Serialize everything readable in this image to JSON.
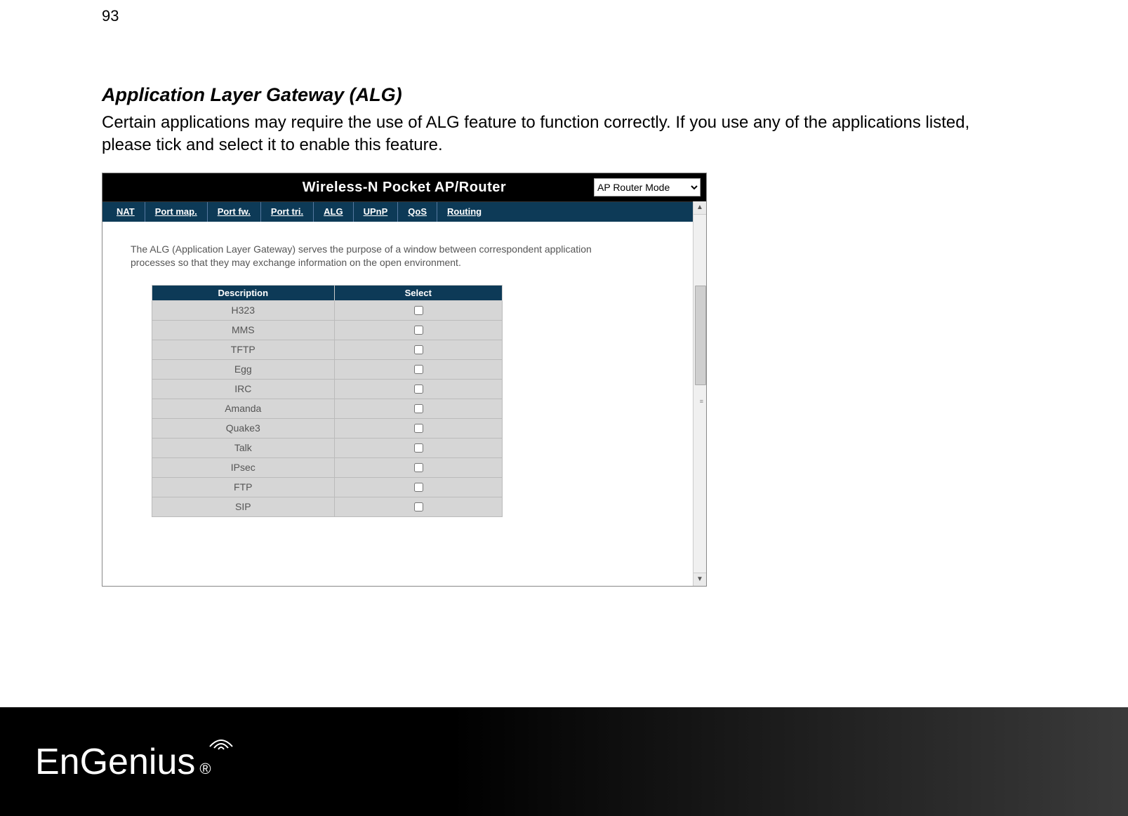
{
  "page_number": "93",
  "section": {
    "title": "Application Layer Gateway (ALG)",
    "body": "Certain applications may require the use of ALG feature to function correctly. If you use any of the applications listed, please tick and select it to enable this feature."
  },
  "app": {
    "title": "Wireless-N Pocket AP/Router",
    "mode_selected": "AP Router Mode",
    "nav_tabs": [
      "NAT",
      "Port map.",
      "Port fw.",
      "Port tri.",
      "ALG",
      "UPnP",
      "QoS",
      "Routing"
    ],
    "intro_text": "The ALG (Application Layer Gateway) serves the purpose of a window between correspondent application processes so that they may exchange information on the open environment.",
    "table": {
      "headers": {
        "description": "Description",
        "select": "Select"
      },
      "rows": [
        {
          "desc": "H323",
          "checked": false
        },
        {
          "desc": "MMS",
          "checked": false
        },
        {
          "desc": "TFTP",
          "checked": false
        },
        {
          "desc": "Egg",
          "checked": false
        },
        {
          "desc": "IRC",
          "checked": false
        },
        {
          "desc": "Amanda",
          "checked": false
        },
        {
          "desc": "Quake3",
          "checked": false
        },
        {
          "desc": "Talk",
          "checked": false
        },
        {
          "desc": "IPsec",
          "checked": false
        },
        {
          "desc": "FTP",
          "checked": false
        },
        {
          "desc": "SIP",
          "checked": false
        }
      ]
    }
  },
  "brand": {
    "name": "EnGenius",
    "registered": "®"
  }
}
